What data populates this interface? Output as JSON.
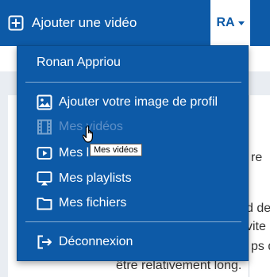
{
  "topbar": {
    "add_video_label": "Ajouter une vidéo",
    "user_initials": "RA",
    "add_video_icon": "plus-square-icon",
    "dropdown_icon": "caret-down-icon"
  },
  "menu": {
    "username": "Ronan Appriou",
    "items": [
      {
        "label": "Ajouter votre image de profil",
        "icon": "image-icon",
        "disabled": false
      },
      {
        "label": "Mes vidéos",
        "icon": "film-icon",
        "disabled": true
      },
      {
        "label": "Mes lives",
        "icon": "play-screen-icon",
        "disabled": false
      },
      {
        "label": "Mes playlists",
        "icon": "cast-icon",
        "disabled": false
      },
      {
        "label": "Mes fichiers",
        "icon": "folder-icon",
        "disabled": false
      }
    ],
    "logout_label": "Déconnexion",
    "logout_icon": "logout-icon"
  },
  "tooltip": "Mes vidéos",
  "background_text": {
    "line1": "re",
    "line2": "d de",
    "line3": "vite",
    "line4": "ps d",
    "line5": "être relativement long."
  },
  "colors": {
    "primary": "#0d5aa7",
    "disabled_text": "#5e8fc6"
  }
}
